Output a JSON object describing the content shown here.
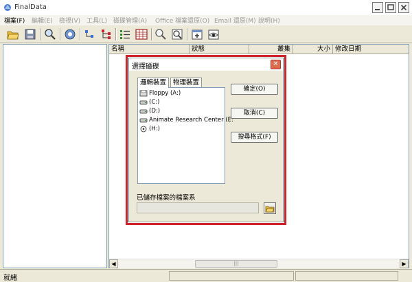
{
  "window": {
    "title": "FinalData"
  },
  "menu": [
    {
      "label": "檔案(F)",
      "active": true
    },
    {
      "label": "編輯(E)"
    },
    {
      "label": "檢視(V)"
    },
    {
      "label": "工具(L)"
    },
    {
      "label": "磁碟管理(A)"
    },
    {
      "label": "Office 檔案還原(O)"
    },
    {
      "label": "Email 還原(M)"
    },
    {
      "label": "說明(H)"
    }
  ],
  "columns": [
    "名稱",
    "狀態",
    "叢集",
    "大小",
    "修改日期"
  ],
  "status": {
    "text": "就緒"
  },
  "dialog": {
    "title": "選擇磁碟",
    "tabs": [
      "邏輯裝置",
      "物理裝置"
    ],
    "devices": [
      {
        "label": "Floppy (A:)",
        "icon": "floppy-drive-icon"
      },
      {
        "label": "(C:)",
        "icon": "hard-drive-icon"
      },
      {
        "label": "(D:)",
        "icon": "hard-drive-icon"
      },
      {
        "label": "Animate Research Center (E:",
        "icon": "hard-drive-icon"
      },
      {
        "label": "(H:)",
        "icon": "cd-drive-icon"
      }
    ],
    "ok_label": "確定(O)",
    "cancel_label": "取消(C)",
    "search_format_label": "搜尋格式(F)",
    "saved_label": "已儲存檔案的檔案系",
    "saved_value": ""
  }
}
